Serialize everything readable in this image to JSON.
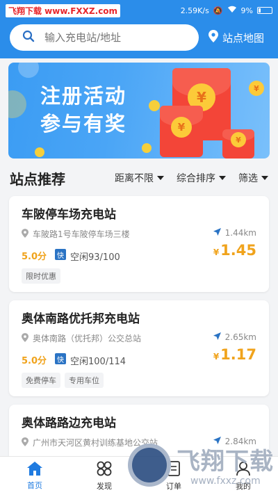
{
  "status_bar": {
    "watermark": "飞翔下载 www.FXXZ.com",
    "speed": "2.59K/s",
    "battery": "9%"
  },
  "search": {
    "placeholder": "输入充电站/地址",
    "map_label": "站点地图"
  },
  "banner": {
    "line1": "注册活动",
    "line2": "参与有奖",
    "coin_symbol": "¥"
  },
  "section": {
    "title": "站点推荐",
    "filters": [
      "距离不限",
      "综合排序",
      "筛选"
    ]
  },
  "stations": [
    {
      "name": "车陂停车场充电站",
      "address": "车陂路1号车陂停车场三楼",
      "distance": "1.44km",
      "score": "5.0分",
      "fast_label": "快",
      "idle": "空闲93/100",
      "currency": "¥",
      "price": "1.45",
      "tags": [
        "限时优惠"
      ]
    },
    {
      "name": "奥体南路优托邦充电站",
      "address": "奥体南路（优托邦）公交总站",
      "distance": "2.65km",
      "score": "5.0分",
      "fast_label": "快",
      "idle": "空闲100/114",
      "currency": "¥",
      "price": "1.17",
      "tags": [
        "免费停车",
        "专用车位"
      ]
    },
    {
      "name": "奥体路路边充电站",
      "address": "广州市天河区黄村训练基地公交站",
      "distance": "2.84km"
    }
  ],
  "tabbar": {
    "items": [
      "首页",
      "发现",
      "订单",
      "我的"
    ]
  },
  "watermark_bottom": {
    "title": "飞翔下载",
    "url": "www.fxxz.com"
  },
  "colors": {
    "primary": "#2b8dea",
    "price": "#f0a31c",
    "fast_badge": "#2a73c4"
  }
}
